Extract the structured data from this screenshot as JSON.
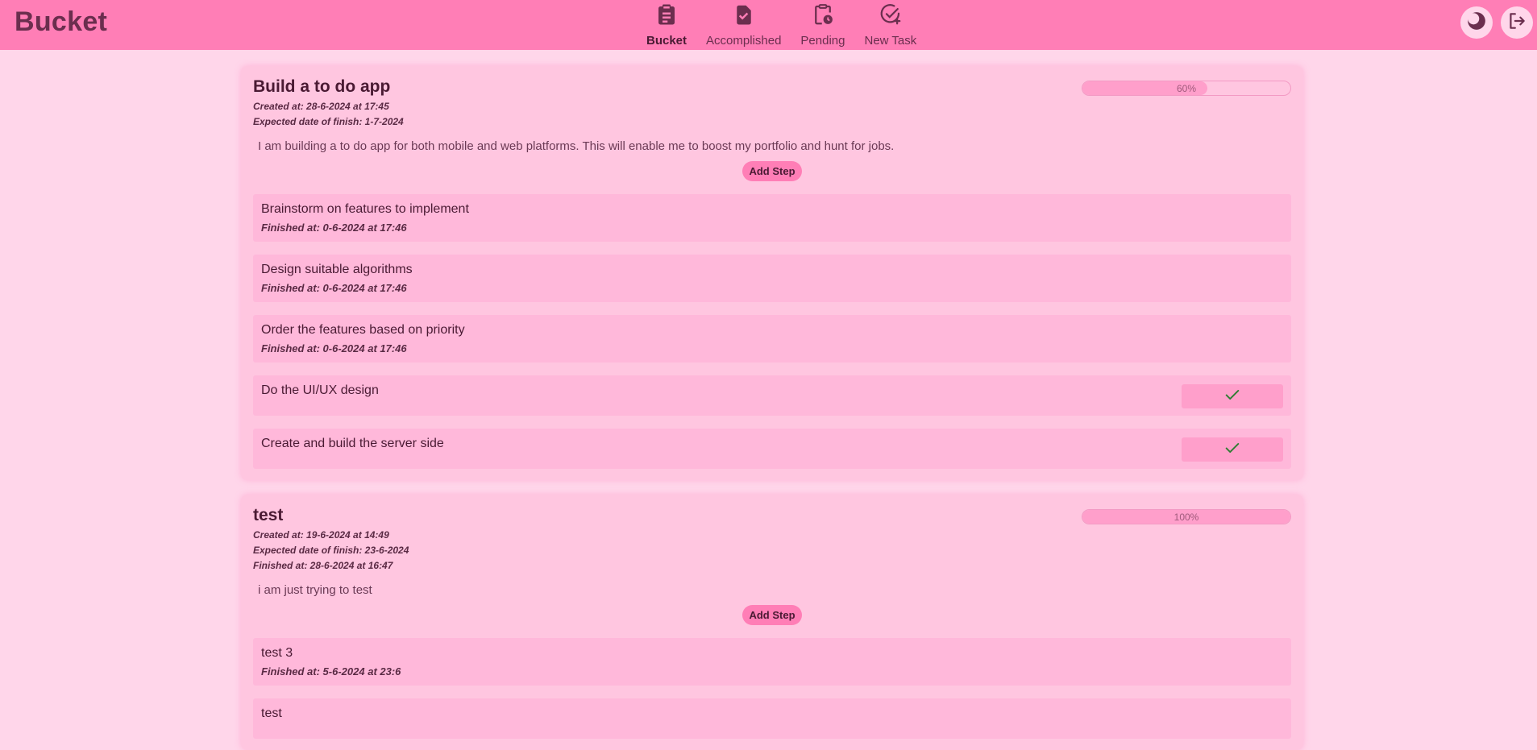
{
  "app": {
    "title": "Bucket"
  },
  "nav": {
    "items": [
      {
        "label": "Bucket",
        "icon": "clipboard-list-icon",
        "active": true
      },
      {
        "label": "Accomplished",
        "icon": "clipboard-check-icon",
        "active": false
      },
      {
        "label": "Pending",
        "icon": "clipboard-clock-icon",
        "active": false
      },
      {
        "label": "New Task",
        "icon": "circle-check-plus-icon",
        "active": false
      }
    ]
  },
  "header_actions": {
    "theme_icon": "moon-icon",
    "logout_icon": "logout-icon"
  },
  "tasks": [
    {
      "title": "Build a to do app",
      "created": "Created at: 28-6-2024 at 17:45",
      "expected": "Expected date of finish: 1-7-2024",
      "description": "I am building a to do app for both mobile and web platforms. This will enable me to boost my portfolio and hunt for jobs.",
      "progress": 0.6,
      "progress_label": "60%",
      "add_step_label": "Add Step",
      "steps": [
        {
          "text": "Brainstorm on features to implement",
          "finished": "Finished at: 0-6-2024 at 17:46"
        },
        {
          "text": "Design suitable algorithms",
          "finished": "Finished at: 0-6-2024 at 17:46"
        },
        {
          "text": "Order the features based on priority",
          "finished": "Finished at: 0-6-2024 at 17:46"
        },
        {
          "text": "Do the UI/UX design",
          "finished": ""
        },
        {
          "text": "Create and build the server side",
          "finished": ""
        }
      ]
    },
    {
      "title": "test",
      "created": "Created at: 19-6-2024 at 14:49",
      "expected": "Expected date of finish: 23-6-2024",
      "finished_at": "Finished at: 28-6-2024 at 16:47",
      "description": "i am just trying to test",
      "progress": 1.0,
      "progress_label": "100%",
      "add_step_label": "Add Step",
      "steps": [
        {
          "text": "test 3",
          "finished": "Finished at: 5-6-2024 at 23:6"
        },
        {
          "text": "test",
          "finished": ""
        }
      ]
    }
  ],
  "colors": {
    "navbar": "#ff7eb6",
    "background": "#ffd6ea",
    "card": "#ffc6e0",
    "step": "#ffb8da",
    "accent": "#ff9fcb",
    "check": "#2e7d32"
  }
}
